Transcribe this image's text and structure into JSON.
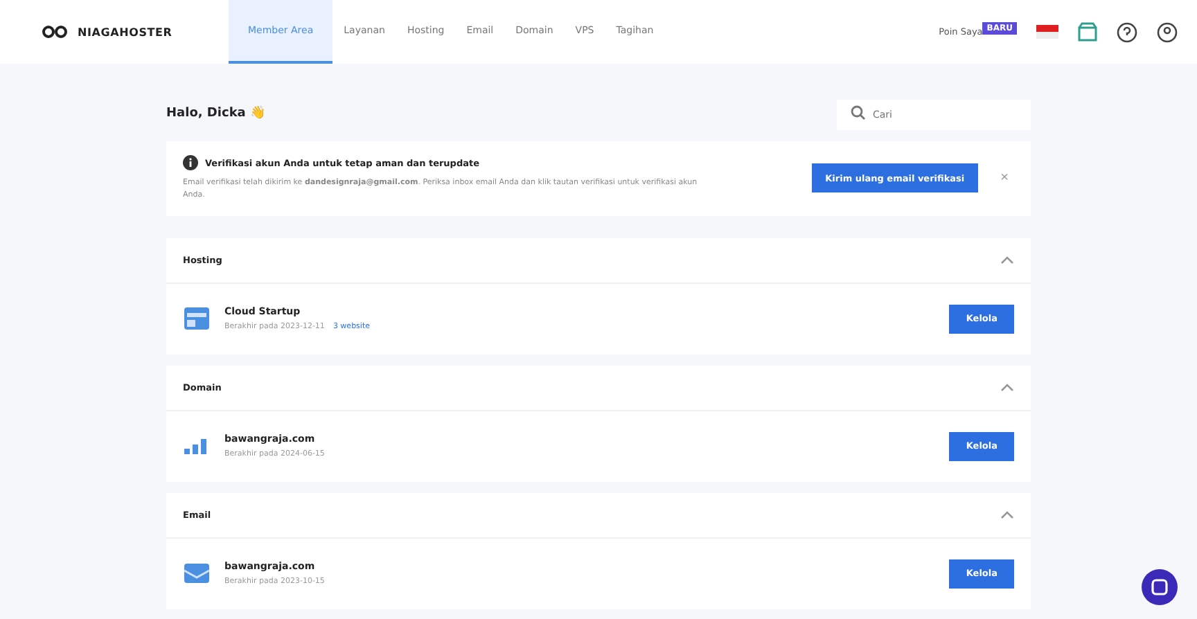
{
  "brand": {
    "name": "NIAGAHOSTER"
  },
  "nav": [
    {
      "label": "Member Area",
      "selected": true
    },
    {
      "label": "Layanan",
      "selected": false
    },
    {
      "label": "Hosting",
      "selected": false
    },
    {
      "label": "Email",
      "selected": false
    },
    {
      "label": "Domain",
      "selected": false
    },
    {
      "label": "VPS",
      "selected": false
    },
    {
      "label": "Tagihan",
      "selected": false
    }
  ],
  "account": {
    "label": "Poin Saya",
    "badge": "BARU"
  },
  "greeting": {
    "text": "Halo, Dicka",
    "emoji": "👋"
  },
  "search": {
    "placeholder": "Cari"
  },
  "notice": {
    "title": "Verifikasi akun Anda untuk tetap aman dan terupdate",
    "text": "Email verifikasi telah dikirim ke **dandesignraja@gmail.com**. Periksa inbox email Anda dan klik tautan verifikasi untuk verifikasi akun Anda.",
    "button": "Kirim ulang email verifikasi",
    "close": "×"
  },
  "sections": [
    {
      "title": "Hosting",
      "expanded": true,
      "items": [
        {
          "kind": "hosting",
          "name": "Cloud Startup",
          "meta": "Berakhir pada 2023-12-11",
          "link": "3 website",
          "button": "Kelola"
        }
      ]
    },
    {
      "title": "Domain",
      "expanded": true,
      "items": [
        {
          "kind": "domain",
          "name": "bawangraja.com",
          "meta": "Berakhir pada 2024-06-15",
          "button": "Kelola"
        }
      ]
    },
    {
      "title": "Email",
      "expanded": true,
      "items": [
        {
          "kind": "email",
          "name": "bawangraja.com",
          "meta": "Berakhir pada 2023-10-15",
          "button": "Kelola"
        }
      ]
    }
  ]
}
